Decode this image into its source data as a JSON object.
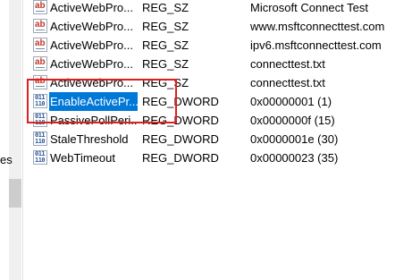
{
  "left_pane": {
    "partial_label": "es"
  },
  "rows": [
    {
      "name": "ActiveWebPro...",
      "type": "REG_SZ",
      "data": "Microsoft Connect Test",
      "icon": "string-value-icon"
    },
    {
      "name": "ActiveWebPro...",
      "type": "REG_SZ",
      "data": "www.msftconnecttest.com",
      "icon": "string-value-icon"
    },
    {
      "name": "ActiveWebPro...",
      "type": "REG_SZ",
      "data": "ipv6.msftconnecttest.com",
      "icon": "string-value-icon"
    },
    {
      "name": "ActiveWebPro...",
      "type": "REG_SZ",
      "data": "connecttest.txt",
      "icon": "string-value-icon"
    },
    {
      "name": "ActiveWebPro...",
      "type": "REG_SZ",
      "data": "connecttest.txt",
      "icon": "string-value-icon"
    },
    {
      "name": "EnableActivePr...",
      "type": "REG_DWORD",
      "data": "0x00000001 (1)",
      "icon": "dword-value-icon",
      "selected": true
    },
    {
      "name": "PassivePollPeri...",
      "type": "REG_DWORD",
      "data": "0x0000000f (15)",
      "icon": "dword-value-icon"
    },
    {
      "name": "StaleThreshold",
      "type": "REG_DWORD",
      "data": "0x0000001e (30)",
      "icon": "dword-value-icon"
    },
    {
      "name": "WebTimeout",
      "type": "REG_DWORD",
      "data": "0x00000023 (35)",
      "icon": "dword-value-icon"
    }
  ],
  "icons": {
    "string_glyph": "ab",
    "dword_glyph": "011\n110"
  },
  "colors": {
    "selection": "#0078d7",
    "annotation_box": "#e01f1f"
  }
}
